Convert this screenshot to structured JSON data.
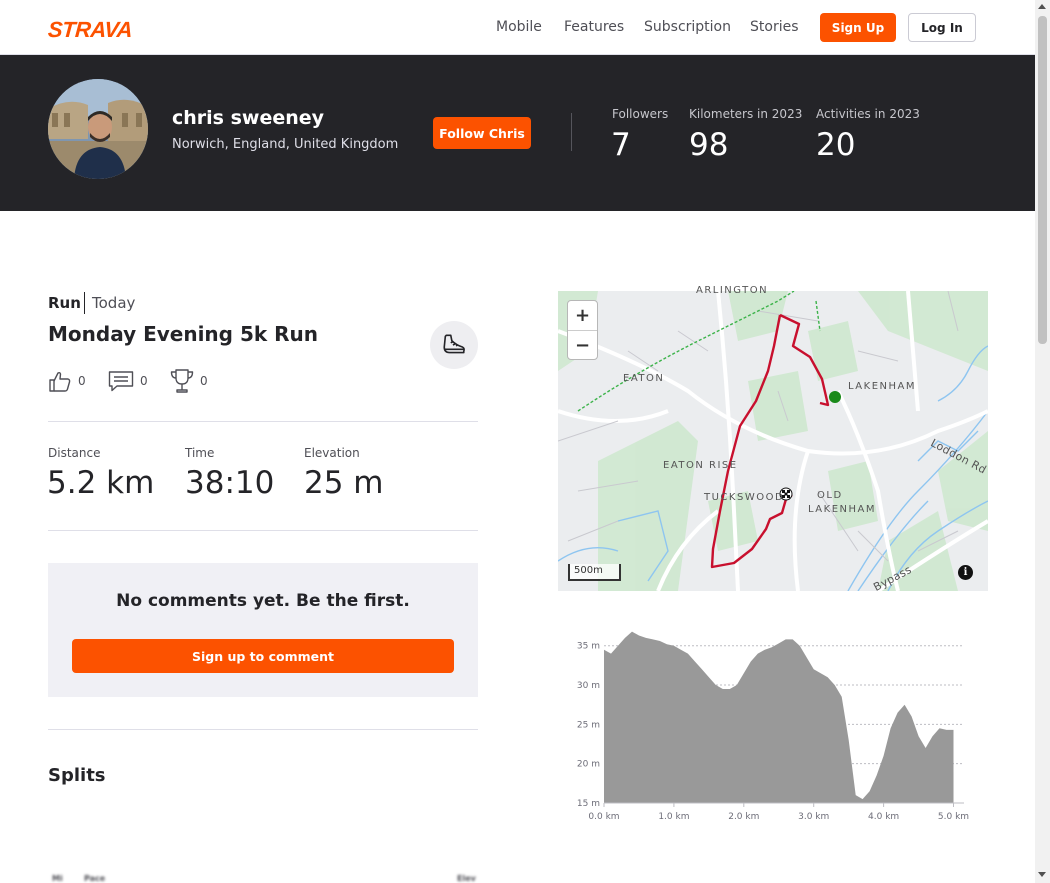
{
  "nav": {
    "logo": "STRAVA",
    "links": [
      "Mobile",
      "Features",
      "Subscription",
      "Stories"
    ],
    "signup": "Sign Up",
    "login": "Log In"
  },
  "athlete": {
    "name": "chris sweeney",
    "location": "Norwich, England, United Kingdom",
    "follow": "Follow Chris",
    "stats": [
      {
        "label": "Followers",
        "value": "7"
      },
      {
        "label": "Kilometers in 2023",
        "value": "98"
      },
      {
        "label": "Activities in 2023",
        "value": "20"
      }
    ]
  },
  "activity": {
    "type": "Run",
    "date": "Today",
    "title": "Monday Evening 5k Run",
    "kudos": "0",
    "comments": "0",
    "achievements": "0",
    "metrics": [
      {
        "label": "Distance",
        "value": "5.2 km"
      },
      {
        "label": "Time",
        "value": "38:10"
      },
      {
        "label": "Elevation",
        "value": "25 m"
      }
    ]
  },
  "comments": {
    "empty": "No comments yet. Be the first.",
    "signup": "Sign up to comment"
  },
  "splits": {
    "title": "Splits",
    "headers": [
      "Mi",
      "Pace",
      "Elev"
    ]
  },
  "map": {
    "labels": [
      "ARLINGTON",
      "EATON",
      "LAKENHAM",
      "EATON RISE",
      "TUCKSWOOD",
      "OLD",
      "LAKENHAM",
      "Loddon Rd",
      "Bypass"
    ],
    "zoom_in": "+",
    "zoom_out": "−",
    "scale": "500m",
    "info": "i",
    "route_color": "#c8102e",
    "start_color": "#1a8a1a"
  },
  "chart_data": {
    "type": "area",
    "x": [
      0.0,
      0.1,
      0.2,
      0.3,
      0.4,
      0.5,
      0.6,
      0.7,
      0.8,
      0.9,
      1.0,
      1.1,
      1.2,
      1.3,
      1.4,
      1.5,
      1.6,
      1.7,
      1.8,
      1.9,
      2.0,
      2.1,
      2.2,
      2.3,
      2.4,
      2.5,
      2.6,
      2.7,
      2.8,
      2.9,
      3.0,
      3.1,
      3.2,
      3.3,
      3.4,
      3.5,
      3.6,
      3.7,
      3.8,
      3.9,
      4.0,
      4.1,
      4.2,
      4.3,
      4.4,
      4.5,
      4.6,
      4.7,
      4.8,
      4.9,
      5.0,
      5.15
    ],
    "values": [
      34.5,
      34.0,
      35.0,
      36.0,
      36.8,
      36.3,
      36.0,
      35.8,
      35.6,
      35.2,
      35.0,
      34.5,
      34.0,
      33.0,
      32.0,
      31.0,
      30.0,
      29.5,
      29.5,
      30.0,
      31.5,
      33.0,
      34.0,
      34.5,
      34.8,
      35.3,
      35.8,
      35.8,
      35.0,
      33.5,
      32.0,
      31.5,
      31.0,
      30.0,
      28.5,
      23.0,
      16.0,
      15.5,
      16.5,
      18.5,
      21.0,
      24.5,
      26.5,
      27.5,
      26.0,
      23.5,
      22.0,
      23.5,
      24.5,
      24.3,
      24.3
    ],
    "x_ticks": [
      "0.0 km",
      "1.0 km",
      "2.0 km",
      "3.0 km",
      "4.0 km",
      "5.0 km"
    ],
    "y_ticks": [
      "15 m",
      "20 m",
      "25 m",
      "30 m",
      "35 m"
    ],
    "xlim": [
      0,
      5.15
    ],
    "ylim": [
      15,
      37
    ],
    "fill_color": "#999999",
    "grid": true
  }
}
